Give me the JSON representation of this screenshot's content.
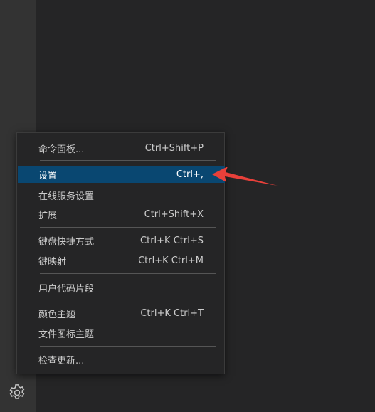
{
  "menu": {
    "items": [
      {
        "label": "命令面板...",
        "shortcut": "Ctrl+Shift+P"
      },
      {
        "label": "设置",
        "shortcut": "Ctrl+,"
      },
      {
        "label": "在线服务设置",
        "shortcut": ""
      },
      {
        "label": "扩展",
        "shortcut": "Ctrl+Shift+X"
      },
      {
        "label": "键盘快捷方式",
        "shortcut": "Ctrl+K Ctrl+S"
      },
      {
        "label": "键映射",
        "shortcut": "Ctrl+K Ctrl+M"
      },
      {
        "label": "用户代码片段",
        "shortcut": ""
      },
      {
        "label": "颜色主题",
        "shortcut": "Ctrl+K Ctrl+T"
      },
      {
        "label": "文件图标主题",
        "shortcut": ""
      },
      {
        "label": "检查更新...",
        "shortcut": ""
      }
    ]
  },
  "activity_bar": {
    "manage_icon": "gear-icon"
  },
  "colors": {
    "menu_background": "#252526",
    "highlight": "#094771",
    "annotation_arrow": "#e8403a"
  }
}
